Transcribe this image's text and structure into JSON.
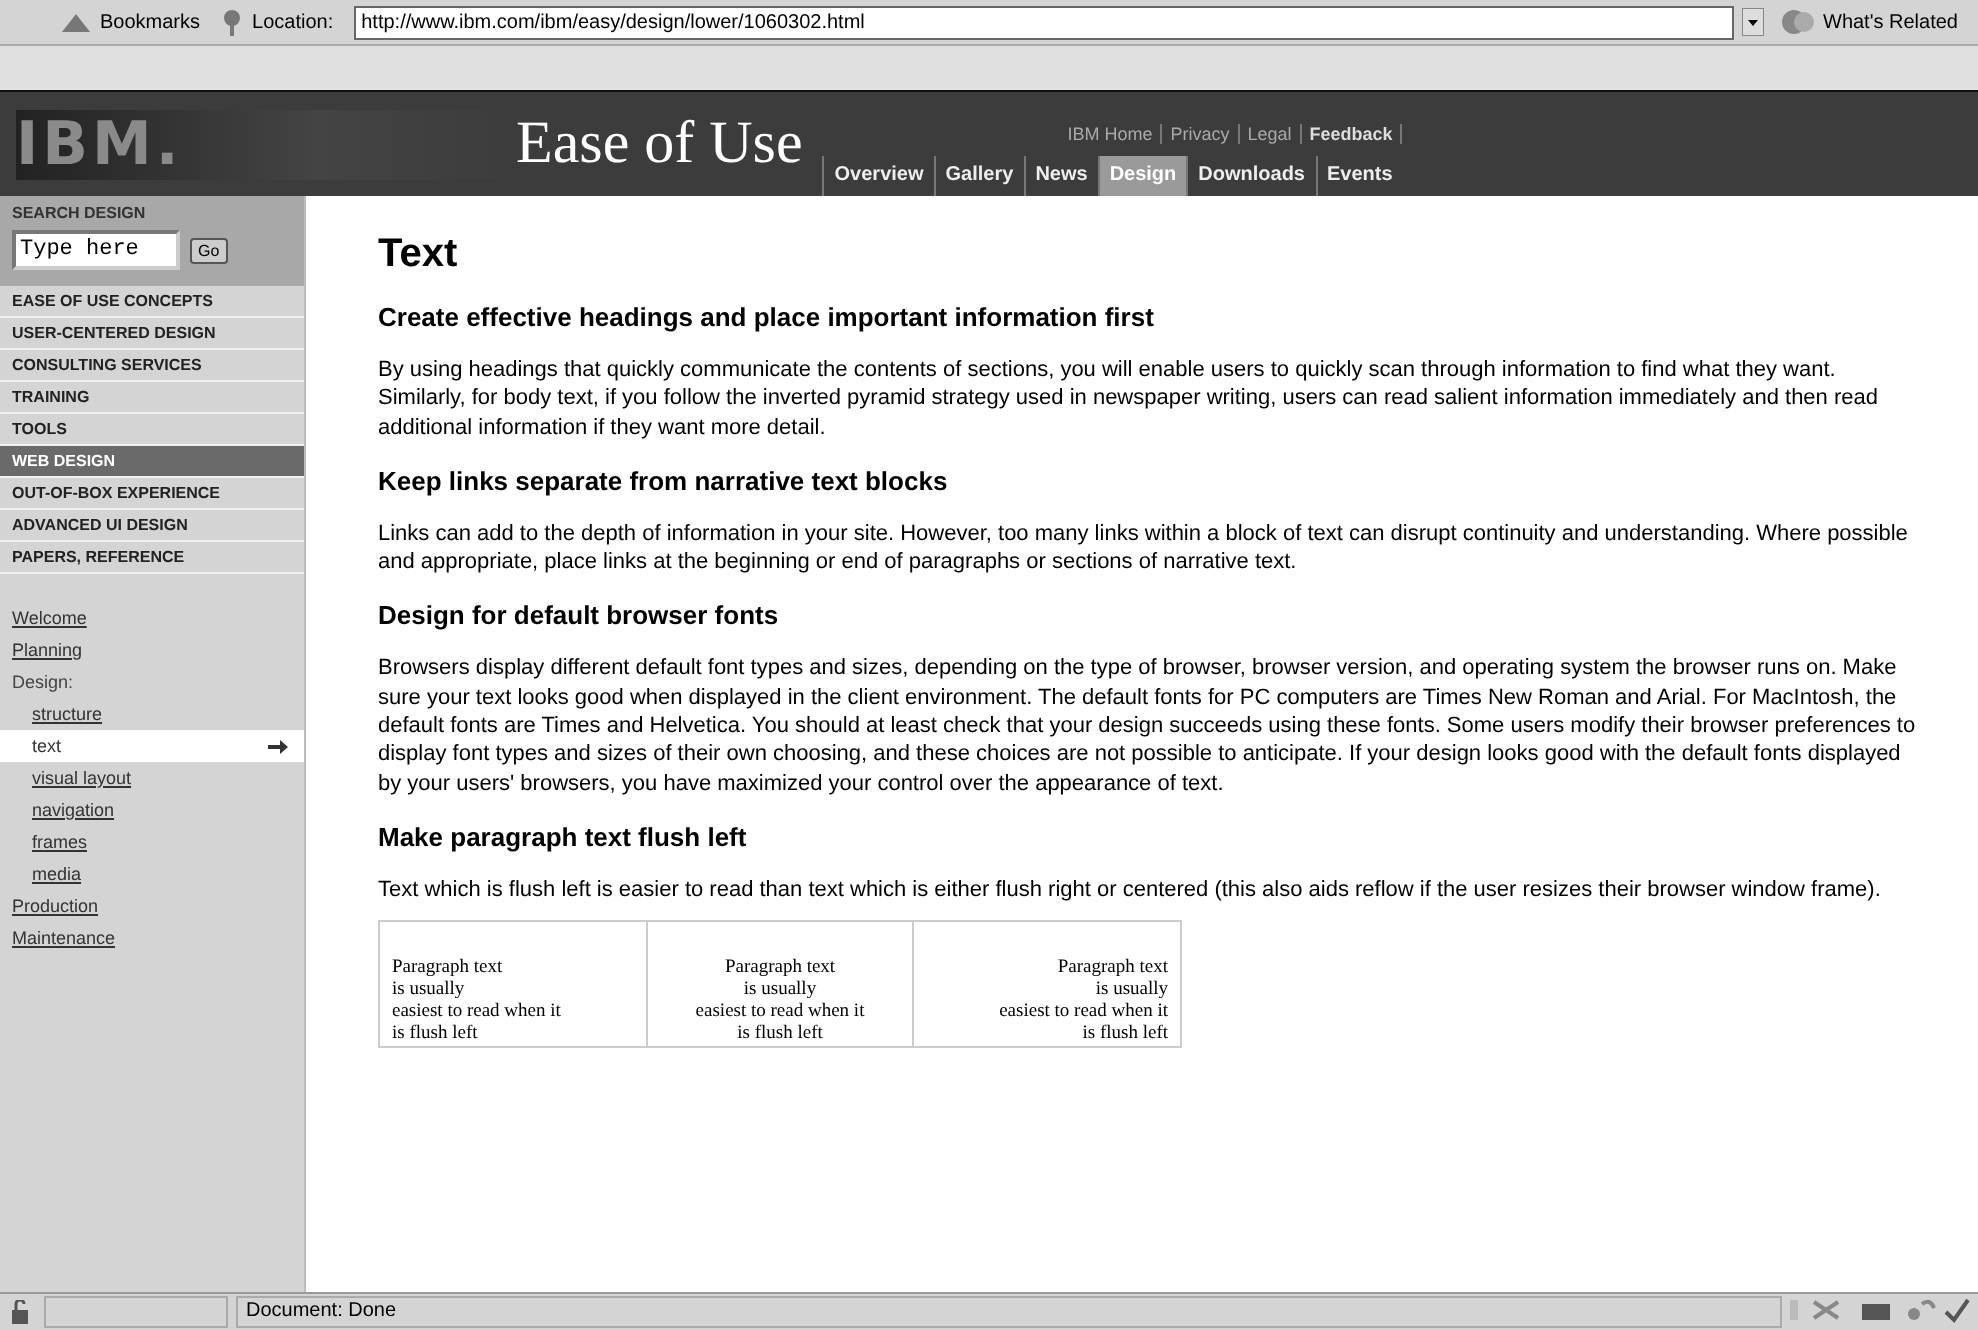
{
  "browser": {
    "bookmarks": "Bookmarks",
    "location_label": "Location:",
    "url": "http://www.ibm.com/ibm/easy/design/lower/1060302.html",
    "whats_related": "What's Related"
  },
  "header": {
    "logo": "IBM.",
    "title": "Ease of Use",
    "top_links": [
      "IBM Home",
      "Privacy",
      "Legal",
      "Feedback"
    ],
    "tabs": [
      {
        "label": "Overview",
        "selected": false
      },
      {
        "label": "Gallery",
        "selected": false
      },
      {
        "label": "News",
        "selected": false
      },
      {
        "label": "Design",
        "selected": true
      },
      {
        "label": "Downloads",
        "selected": false
      },
      {
        "label": "Events",
        "selected": false
      }
    ]
  },
  "sidebar": {
    "search_title": "SEARCH DESIGN",
    "search": {
      "placeholder": "Type here"
    },
    "go": "Go",
    "sections": [
      {
        "label": "EASE OF USE CONCEPTS",
        "selected": false
      },
      {
        "label": "USER-CENTERED DESIGN",
        "selected": false
      },
      {
        "label": "CONSULTING SERVICES",
        "selected": false
      },
      {
        "label": "TRAINING",
        "selected": false
      },
      {
        "label": "TOOLS",
        "selected": false
      },
      {
        "label": "WEB DESIGN",
        "selected": true
      },
      {
        "label": "OUT-OF-BOX EXPERIENCE",
        "selected": false
      },
      {
        "label": "ADVANCED UI DESIGN",
        "selected": false
      },
      {
        "label": "PAPERS, REFERENCE",
        "selected": false
      }
    ],
    "pages": [
      {
        "label": "Welcome",
        "kind": "link"
      },
      {
        "label": "Planning",
        "kind": "link"
      },
      {
        "label": "Design:",
        "kind": "heading",
        "children": [
          {
            "label": "structure",
            "selected": false
          },
          {
            "label": "text",
            "selected": true
          },
          {
            "label": "visual layout",
            "selected": false
          },
          {
            "label": "navigation",
            "selected": false
          },
          {
            "label": "frames",
            "selected": false
          },
          {
            "label": "media",
            "selected": false
          }
        ]
      },
      {
        "label": "Production",
        "kind": "link"
      },
      {
        "label": "Maintenance",
        "kind": "link"
      }
    ]
  },
  "content": {
    "title": "Text",
    "sections": [
      {
        "heading": "Create effective headings and place important information first",
        "body": "By using headings that quickly communicate the contents of sections, you will enable users to quickly scan through information to find what they want. Similarly, for body text, if you follow the inverted pyramid strategy used in newspaper writing, users can read salient information immediately and then read additional information if they want more detail."
      },
      {
        "heading": "Keep links separate from narrative text blocks",
        "body": "Links can add to the depth of information in your site. However, too many links within a block of text can disrupt continuity and understanding. Where possible and appropriate, place links at the beginning or end of paragraphs or sections of narrative text."
      },
      {
        "heading": "Design for default browser fonts",
        "body": "Browsers display different default font types and sizes, depending on the type of browser, browser version, and operating system the browser runs on. Make sure your text looks good when displayed in the client environment. The default fonts for PC computers are Times New Roman and Arial. For MacIntosh, the default fonts are Times and Helvetica. You should at least check that your design succeeds using these fonts. Some users modify their browser preferences to display font types and sizes of their own choosing, and these choices are not possible to anticipate. If your design looks good with the default fonts displayed by your users' browsers, you have maximized your control over the appearance of text."
      },
      {
        "heading": "Make paragraph text flush left",
        "body": "Text which is flush left is easier to read than text which is either flush right or centered (this also aids reflow if the user resizes their browser window frame)."
      }
    ],
    "examples": [
      {
        "kind": "left",
        "lines": [
          "Paragraph text",
          "is usually",
          "easiest to read when it",
          "is flush left"
        ]
      },
      {
        "kind": "center",
        "lines": [
          "Paragraph text",
          "is usually",
          "easiest to read when it",
          "is flush left"
        ]
      },
      {
        "kind": "right",
        "lines": [
          "Paragraph text",
          "is usually",
          "easiest to read when it",
          "is flush left"
        ]
      }
    ]
  },
  "status_bar": {
    "text": "Document: Done"
  }
}
